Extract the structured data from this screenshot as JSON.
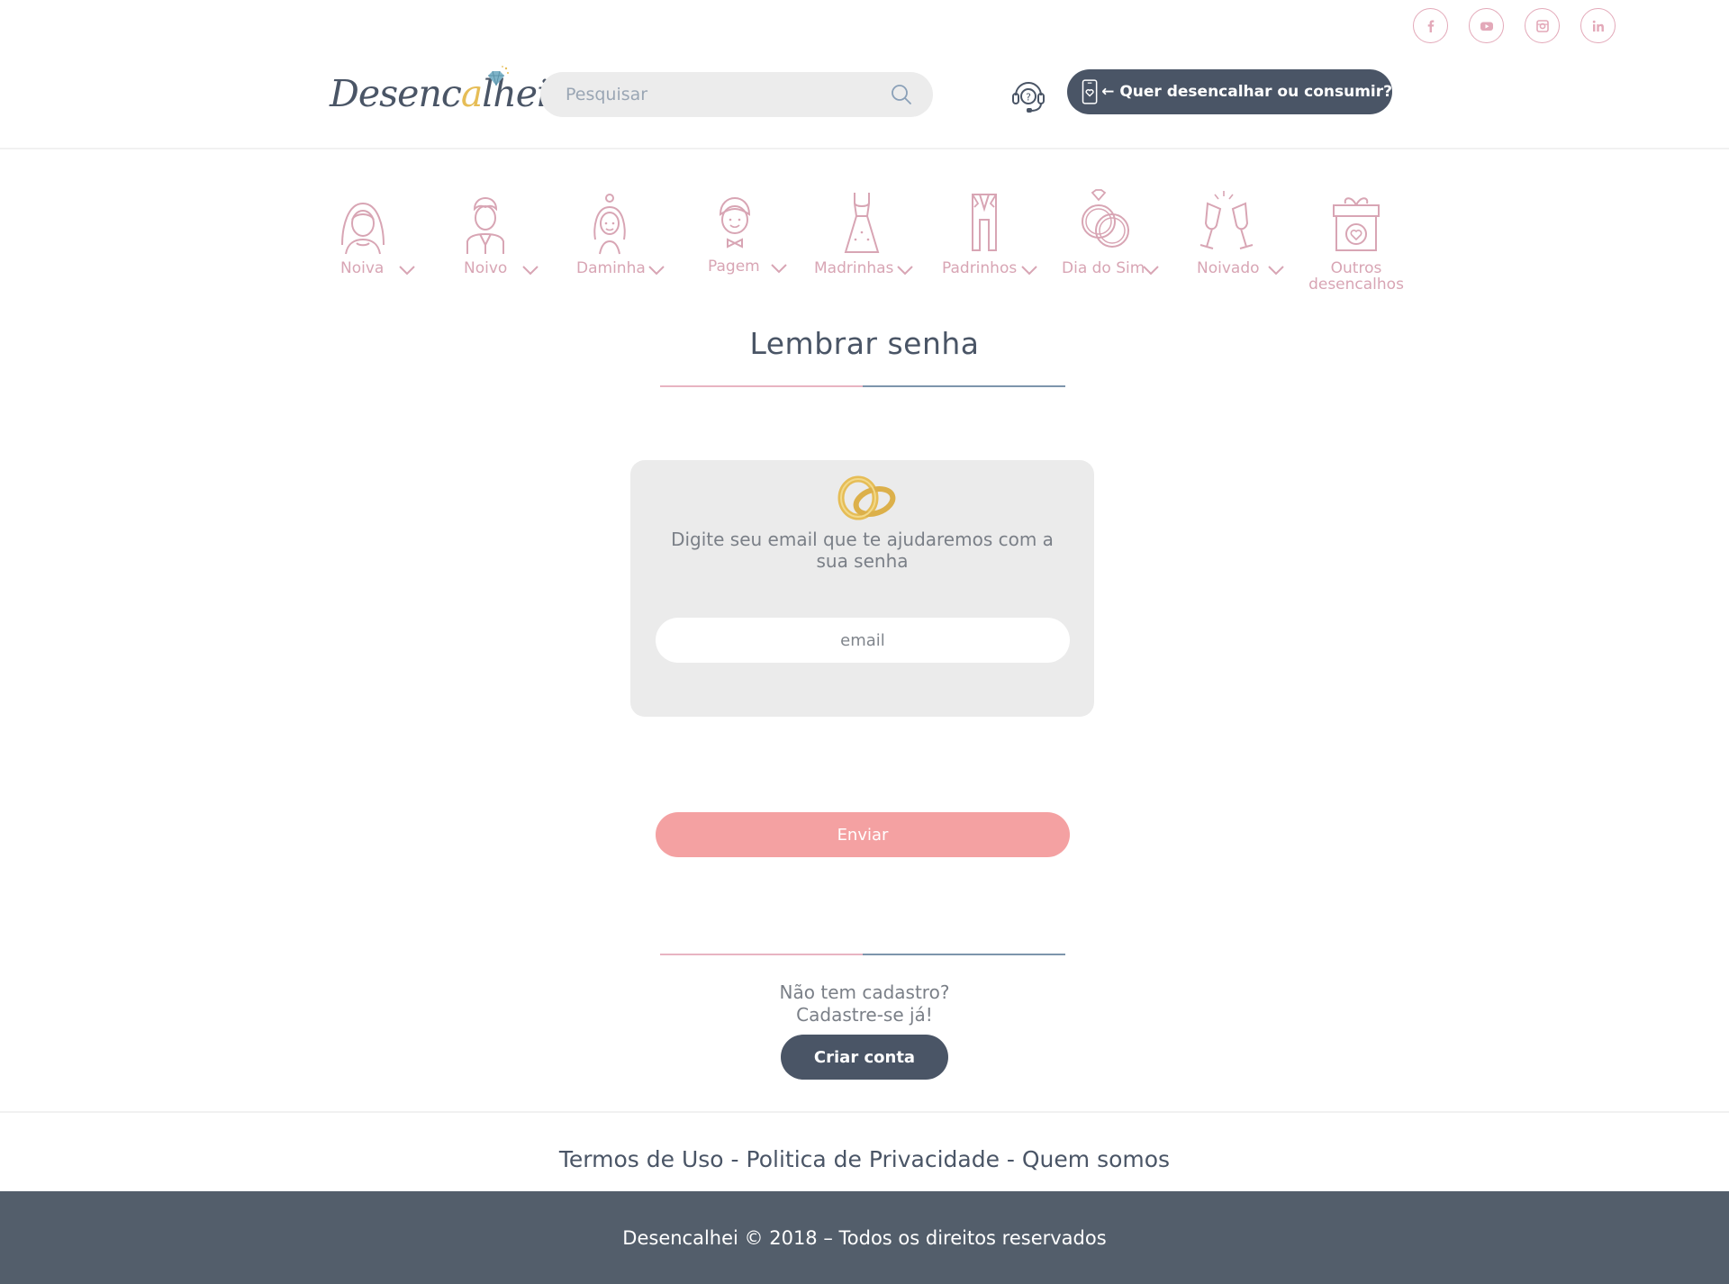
{
  "social": [
    {
      "name": "facebook-icon"
    },
    {
      "name": "youtube-icon"
    },
    {
      "name": "instagram-icon"
    },
    {
      "name": "linkedin-icon"
    }
  ],
  "header": {
    "logo_text_1": "Desenc",
    "logo_text_2": "a",
    "logo_text_3": "lhei",
    "search_placeholder": "Pesquisar",
    "cta_label": "← Quer desencalhar ou consumir?"
  },
  "categories": [
    {
      "label": "Noiva",
      "icon": "bride-icon",
      "has_dropdown": true
    },
    {
      "label": "Noivo",
      "icon": "groom-icon",
      "has_dropdown": true
    },
    {
      "label": "Daminha",
      "icon": "flower-girl-icon",
      "has_dropdown": true
    },
    {
      "label": "Pagem",
      "icon": "page-boy-icon",
      "has_dropdown": true
    },
    {
      "label": "Madrinhas",
      "icon": "dress-icon",
      "has_dropdown": true
    },
    {
      "label": "Padrinhos",
      "icon": "suit-icon",
      "has_dropdown": true
    },
    {
      "label": "Dia do Sim",
      "icon": "rings-icon",
      "has_dropdown": true
    },
    {
      "label": "Noivado",
      "icon": "champagne-icon",
      "has_dropdown": true
    },
    {
      "label": "Outros desencalhos",
      "label_line1": "Outros",
      "label_line2": "desencalhos",
      "icon": "gift-icon",
      "has_dropdown": false
    }
  ],
  "page": {
    "title": "Lembrar senha",
    "message": "Digite seu email que te ajudaremos com a sua senha",
    "email_placeholder": "email",
    "send_label": "Enviar",
    "no_account_line1": "Não tem cadastro?",
    "no_account_line2": "Cadastre-se já!",
    "create_label": "Criar conta"
  },
  "footer": {
    "terms": "Termos de Uso",
    "privacy": "Politica de Privacidade",
    "about": "Quem somos",
    "separator": " - ",
    "copyright": "Desencalhei © 2018 – Todos os direitos reservados"
  },
  "colors": {
    "primary": "#4a5566",
    "accent_pink": "#f4a1a2",
    "icon_pink": "#d8a5b4",
    "gold": "#e6bd56",
    "footer_bg": "#535e6b"
  }
}
